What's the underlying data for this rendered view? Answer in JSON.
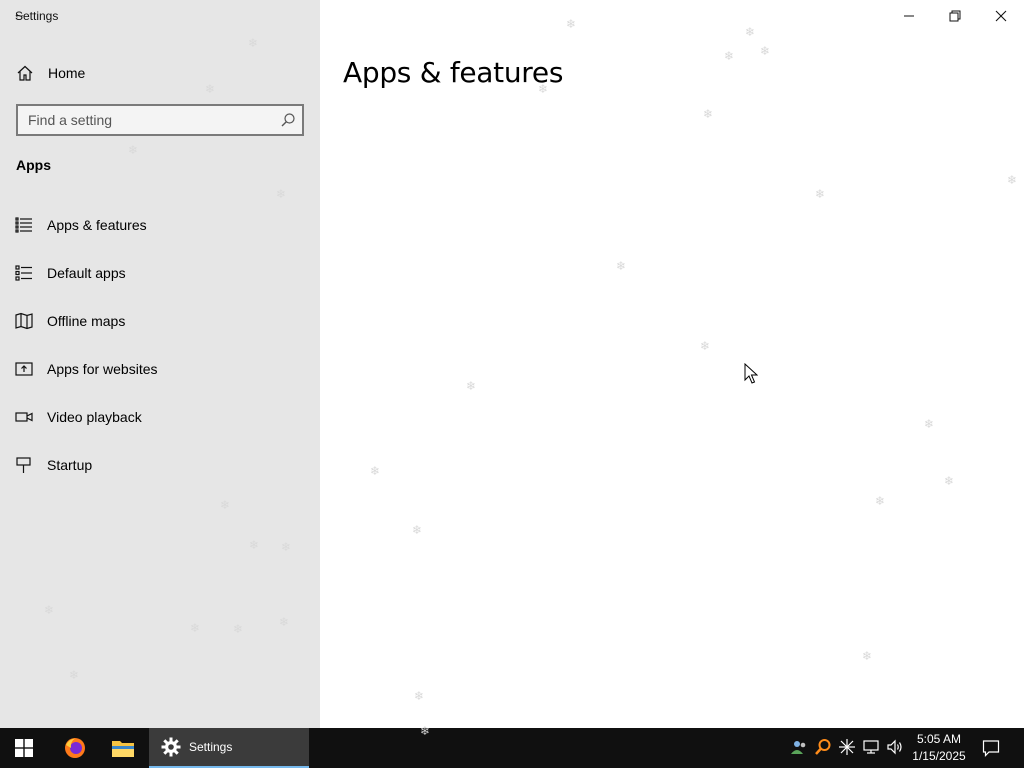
{
  "window": {
    "title": "Settings",
    "controls": {
      "minimize": "minimize",
      "restore": "restore",
      "close": "close"
    }
  },
  "sidebar": {
    "home_label": "Home",
    "search_placeholder": "Find a setting",
    "section_title": "Apps",
    "items": [
      {
        "label": "Apps & features",
        "icon": "list-icon"
      },
      {
        "label": "Default apps",
        "icon": "default-apps-icon"
      },
      {
        "label": "Offline maps",
        "icon": "map-icon"
      },
      {
        "label": "Apps for websites",
        "icon": "open-in-new-icon"
      },
      {
        "label": "Video playback",
        "icon": "video-icon"
      },
      {
        "label": "Startup",
        "icon": "startup-icon"
      }
    ]
  },
  "main": {
    "page_title": "Apps & features"
  },
  "taskbar": {
    "settings_label": "Settings",
    "clock_time": "5:05 AM",
    "clock_date": "1/15/2025",
    "accent": "#76b9ed"
  }
}
